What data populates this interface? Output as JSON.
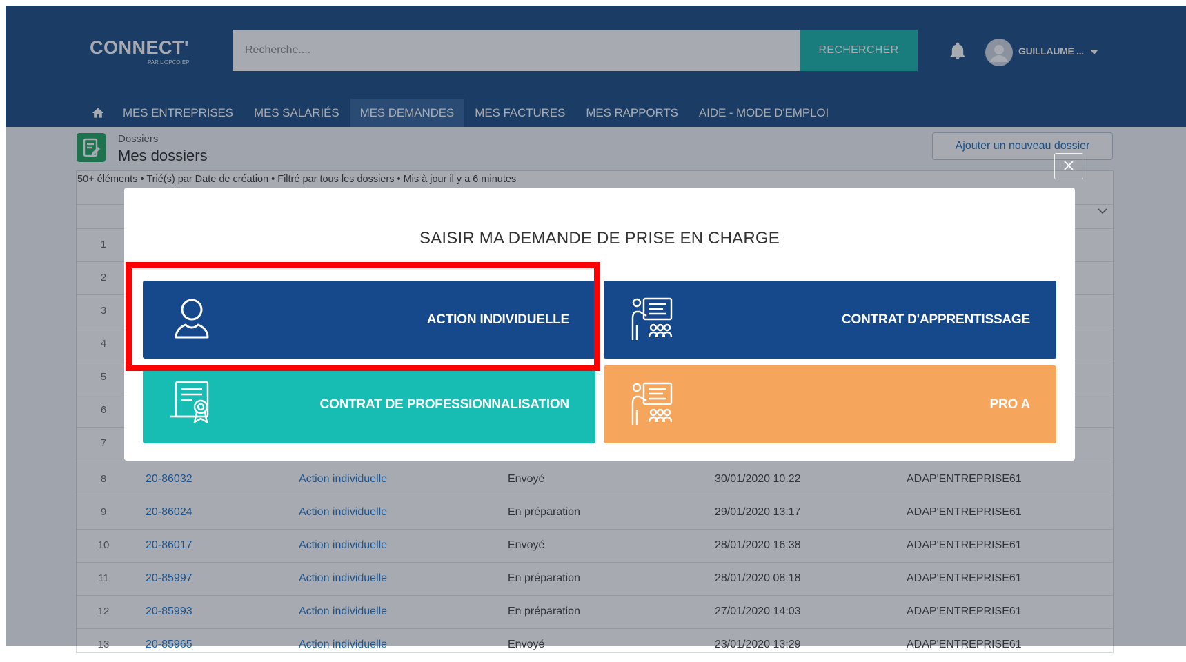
{
  "logo": {
    "main": "CONNECT'",
    "sub": "PAR L'OPCO EP"
  },
  "search": {
    "placeholder": "Recherche....",
    "button_label": "RECHERCHER"
  },
  "user": {
    "name": "GUILLAUME ..."
  },
  "nav": {
    "items": [
      {
        "label": "MES ENTREPRISES"
      },
      {
        "label": "MES SALARIÉS"
      },
      {
        "label": "MES DEMANDES",
        "active": true
      },
      {
        "label": "MES FACTURES"
      },
      {
        "label": "MES RAPPORTS"
      },
      {
        "label": "AIDE - MODE D'EMPLOI"
      }
    ]
  },
  "page": {
    "breadcrumb": "Dossiers",
    "title": "Mes dossiers",
    "add_button": "Ajouter un nouveau dossier",
    "meta": "50+ éléments • Trié(s) par Date de création • Filtré par tous les dossiers • Mis à jour il y a 6 minutes"
  },
  "table": {
    "rows": [
      {
        "num": "1"
      },
      {
        "num": "2"
      },
      {
        "num": "3"
      },
      {
        "num": "4"
      },
      {
        "num": "5"
      },
      {
        "num": "6"
      },
      {
        "num": "7"
      },
      {
        "num": "8",
        "id": "20-86032",
        "type": "Action individuelle",
        "status": "Envoyé",
        "date": "30/01/2020 10:22",
        "company": "ADAP'ENTREPRISE61"
      },
      {
        "num": "9",
        "id": "20-86024",
        "type": "Action individuelle",
        "status": "En préparation",
        "date": "29/01/2020 13:17",
        "company": "ADAP'ENTREPRISE61"
      },
      {
        "num": "10",
        "id": "20-86017",
        "type": "Action individuelle",
        "status": "Envoyé",
        "date": "28/01/2020 16:38",
        "company": "ADAP'ENTREPRISE61"
      },
      {
        "num": "11",
        "id": "20-85997",
        "type": "Action individuelle",
        "status": "En préparation",
        "date": "28/01/2020 08:18",
        "company": "ADAP'ENTREPRISE61"
      },
      {
        "num": "12",
        "id": "20-85993",
        "type": "Action individuelle",
        "status": "En préparation",
        "date": "27/01/2020 14:03",
        "company": "ADAP'ENTREPRISE61"
      },
      {
        "num": "13",
        "id": "20-85965",
        "type": "Action individuelle",
        "status": "Envoyé",
        "date": "23/01/2020 13:29",
        "company": "ADAP'ENTREPRISE61"
      }
    ]
  },
  "modal": {
    "title": "SAISIR MA DEMANDE DE PRISE EN CHARGE",
    "options": {
      "action_individuelle": {
        "label": "ACTION INDIVIDUELLE",
        "icon": "person-icon",
        "color": "#16498c"
      },
      "contrat_apprentissage": {
        "label": "CONTRAT D'APPRENTISSAGE",
        "icon": "trainer-icon",
        "color": "#16498c"
      },
      "contrat_professionnalisation": {
        "label": "CONTRAT DE PROFESSIONNALISATION",
        "icon": "certificate-icon",
        "color": "#17bdb3"
      },
      "pro_a": {
        "label": "PRO A",
        "icon": "trainer-icon",
        "color": "#f6a55d"
      }
    }
  },
  "colors": {
    "header": "#16467f",
    "accent": "#14b3a9",
    "highlight": "#ff0000"
  }
}
